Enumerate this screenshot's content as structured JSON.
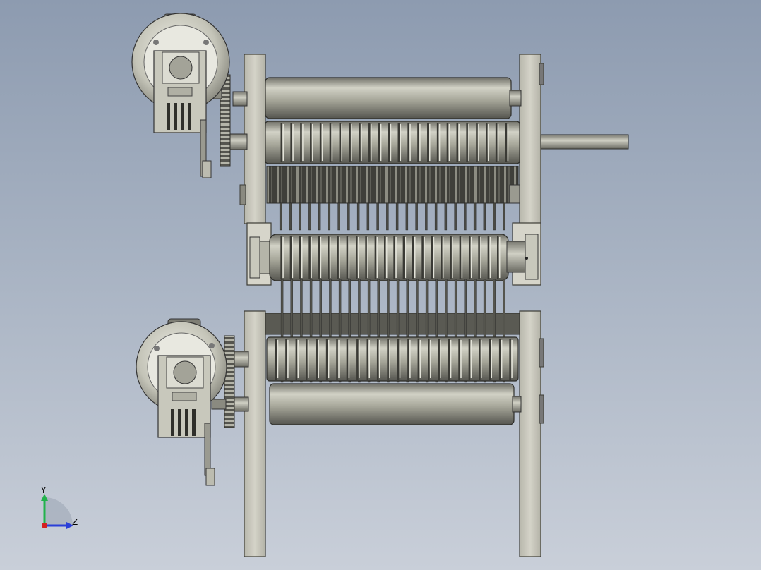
{
  "viewport": {
    "background_top": "#8d9bb0",
    "background_bottom": "#c9cfd9"
  },
  "triad": {
    "y_label": "Y",
    "z_label": "Z",
    "y_color": "#22b24c",
    "z_color": "#2a3fd8",
    "origin_color": "#d42020"
  },
  "model": {
    "frame_color": "#c9c8bd",
    "metal_color": "#b9b9ad",
    "motors": 2,
    "upper_blade_count": 24,
    "lower_blade_count": 24
  }
}
